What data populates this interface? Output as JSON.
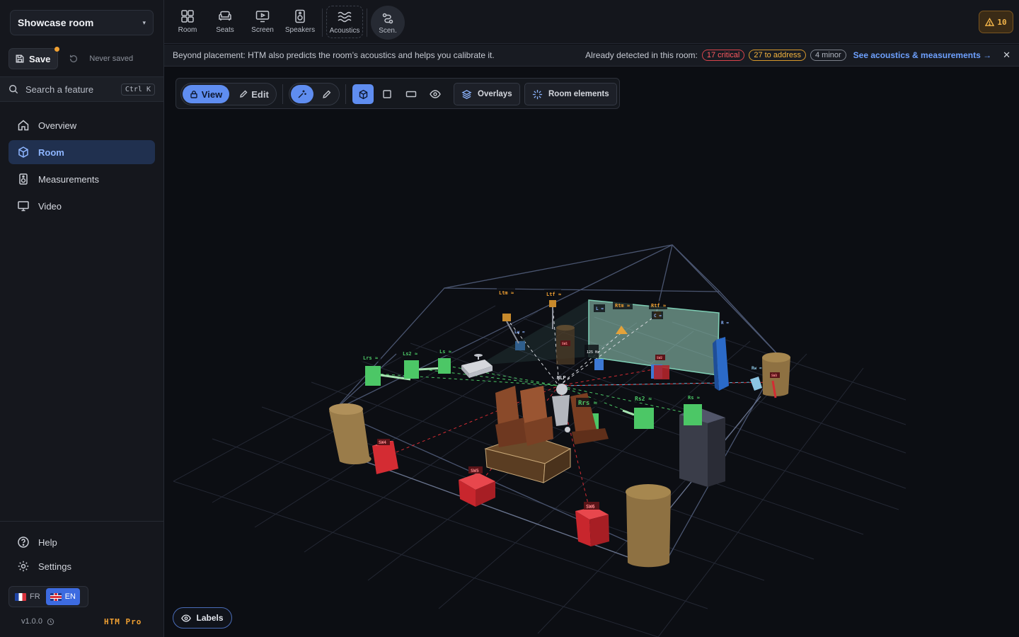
{
  "sidebar": {
    "room_select": "Showcase room",
    "save_label": "Save",
    "save_status": "Never saved",
    "search_placeholder": "Search a feature",
    "search_shortcut": "Ctrl K",
    "nav": [
      {
        "label": "Overview",
        "icon": "home-icon"
      },
      {
        "label": "Room",
        "icon": "cube-icon",
        "active": true
      },
      {
        "label": "Measurements",
        "icon": "speaker-icon"
      },
      {
        "label": "Video",
        "icon": "monitor-icon"
      }
    ],
    "help_label": "Help",
    "settings_label": "Settings",
    "lang_fr": "FR",
    "lang_en": "EN",
    "version": "v1.0.0",
    "edition": "HTM Pro"
  },
  "toolbar": {
    "tools": [
      {
        "label": "Room",
        "icon": "grid-icon"
      },
      {
        "label": "Seats",
        "icon": "sofa-icon"
      },
      {
        "label": "Screen",
        "icon": "screen-icon"
      },
      {
        "label": "Speakers",
        "icon": "speaker-icon"
      },
      {
        "label": "Acoustics",
        "icon": "waves-icon"
      },
      {
        "label": "Scen.",
        "icon": "route-icon"
      }
    ],
    "warnings_count": "10"
  },
  "infobar": {
    "message": "Beyond placement: HTM also predicts the room’s acoustics and helps you calibrate it.",
    "detected_label": "Already detected in this room:",
    "critical": "17 critical",
    "to_address": "27 to address",
    "minor": "4 minor",
    "link": "See acoustics & measurements →",
    "close": "✕"
  },
  "viewport": {
    "view_label": "View",
    "edit_label": "Edit",
    "overlays_label": "Overlays",
    "room_elements_label": "Room elements",
    "labels_label": "Labels"
  },
  "scene_labels": {
    "lrs": "Lrs ≈",
    "ls2": "Ls2 ≈",
    "ls": "Ls ≈",
    "ltm": "Ltm ≈",
    "ltf": "Ltf ≈",
    "rtm": "Rtm ≈",
    "rtf": "Rtf ≈",
    "rrs": "Rrs ≈",
    "rs2": "Rs2 ≈",
    "rs": "Rs ≈",
    "rw": "Rw ≈",
    "lw": "Lw ≈",
    "l": "L ≈",
    "c": "C ≈",
    "r": "R ≈",
    "mlp": "MLP",
    "hz": "125 Hz",
    "sw1": "SW1",
    "sw2": "SW2",
    "sw3": "SW3",
    "sw4": "SW4",
    "sw5": "SW5",
    "sw6": "SW6"
  },
  "colors": {
    "accent": "#5f8df0",
    "critical": "#ff5a60",
    "warning": "#f5b53f",
    "surround": "#4cc766",
    "subwoofer": "#d42c33",
    "brand": "#f0a032"
  }
}
